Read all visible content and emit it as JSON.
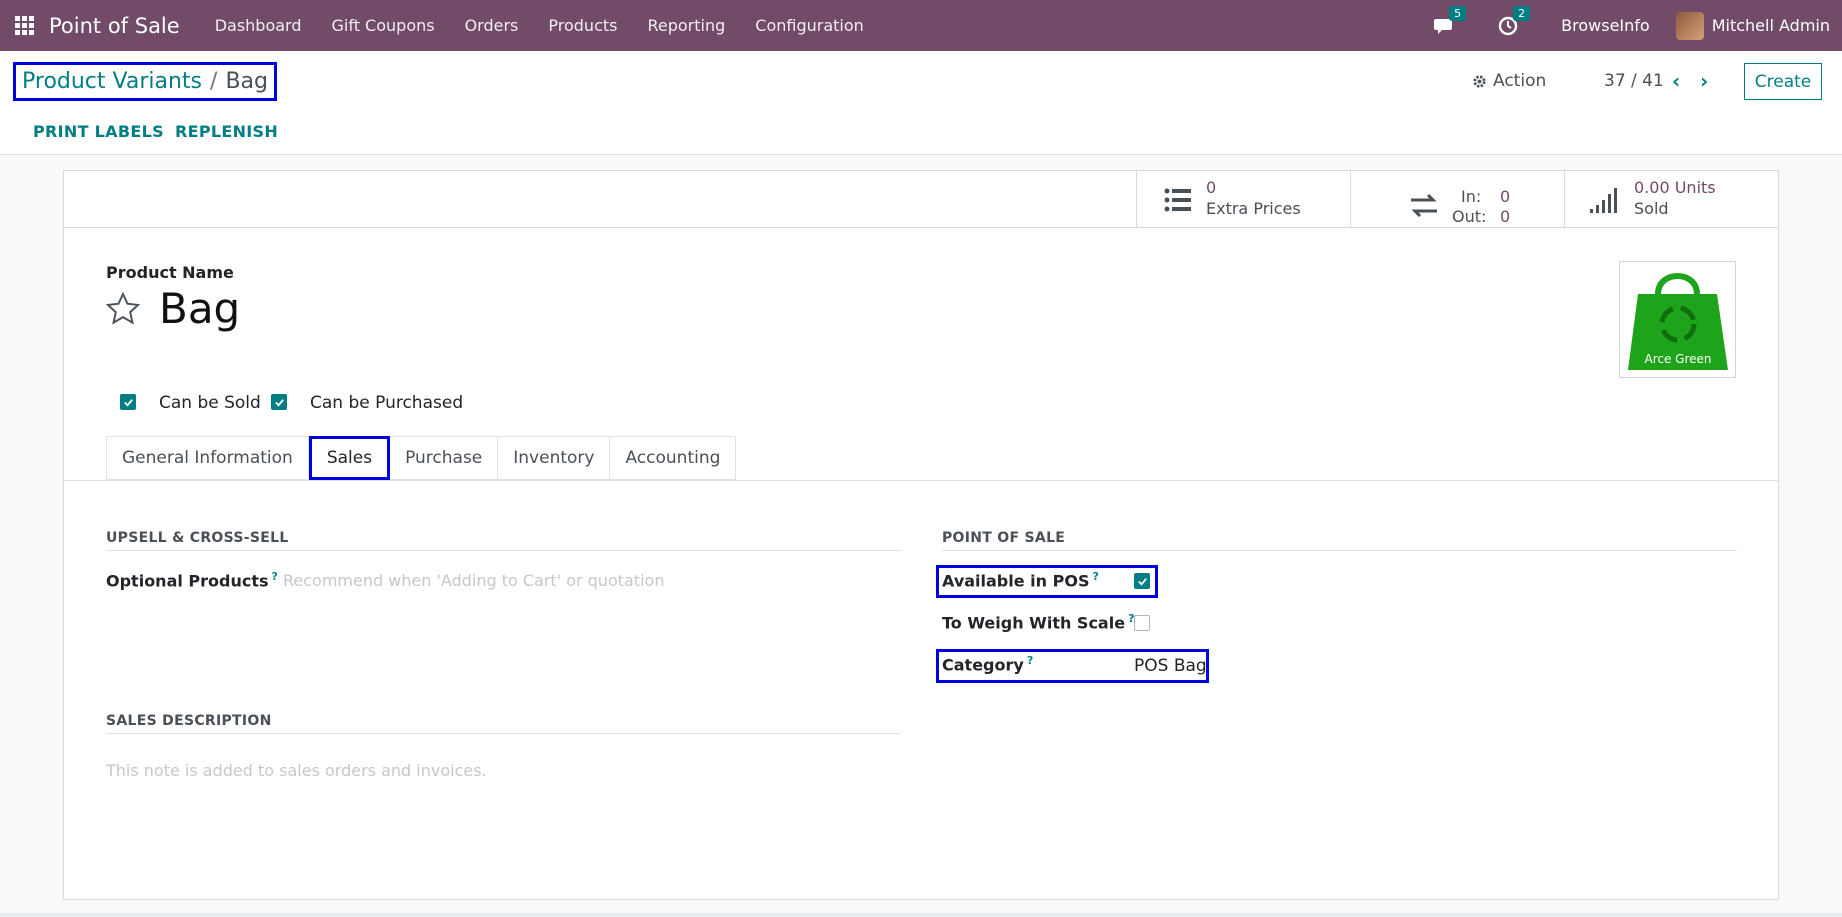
{
  "navbar": {
    "app_name": "Point of Sale",
    "menu": [
      "Dashboard",
      "Gift Coupons",
      "Orders",
      "Products",
      "Reporting",
      "Configuration"
    ],
    "messages_count": "5",
    "activities_count": "2",
    "company": "BrowseInfo",
    "user": "Mitchell Admin"
  },
  "breadcrumb": {
    "parent": "Product Variants",
    "separator": "/",
    "current": "Bag"
  },
  "control": {
    "action_label": "Action",
    "pager": "37 / 41",
    "create_label": "Create",
    "print_labels": "PRINT LABELS",
    "replenish": "REPLENISH"
  },
  "stats": {
    "extra_prices_value": "0",
    "extra_prices_label": "Extra Prices",
    "in_label": "In:",
    "in_value": "0",
    "out_label": "Out:",
    "out_value": "0",
    "sold_value": "0.00 Units",
    "sold_label": "Sold"
  },
  "product": {
    "name_label": "Product Name",
    "name": "Bag",
    "image_caption": "Arce Green",
    "can_be_sold_label": "Can be Sold",
    "can_be_sold": true,
    "can_be_purchased_label": "Can be Purchased",
    "can_be_purchased": true
  },
  "tabs": [
    {
      "label": "General Information",
      "active": false
    },
    {
      "label": "Sales",
      "active": true
    },
    {
      "label": "Purchase",
      "active": false
    },
    {
      "label": "Inventory",
      "active": false
    },
    {
      "label": "Accounting",
      "active": false
    }
  ],
  "sales_tab": {
    "upsell_title": "UPSELL & CROSS-SELL",
    "optional_products_label": "Optional Products",
    "optional_products_placeholder": "Recommend when 'Adding to Cart' or quotation",
    "help_mark": "?",
    "pos_title": "POINT OF SALE",
    "available_in_pos_label": "Available in POS",
    "available_in_pos": true,
    "to_weigh_label": "To Weigh With Scale",
    "to_weigh": false,
    "category_label": "Category",
    "category_value": "POS Bag",
    "sales_desc_title": "SALES DESCRIPTION",
    "sales_desc_placeholder": "This note is added to sales orders and invoices."
  },
  "colors": {
    "navbar": "#714b67",
    "accent": "#017e84",
    "highlight": "#0000e0"
  }
}
